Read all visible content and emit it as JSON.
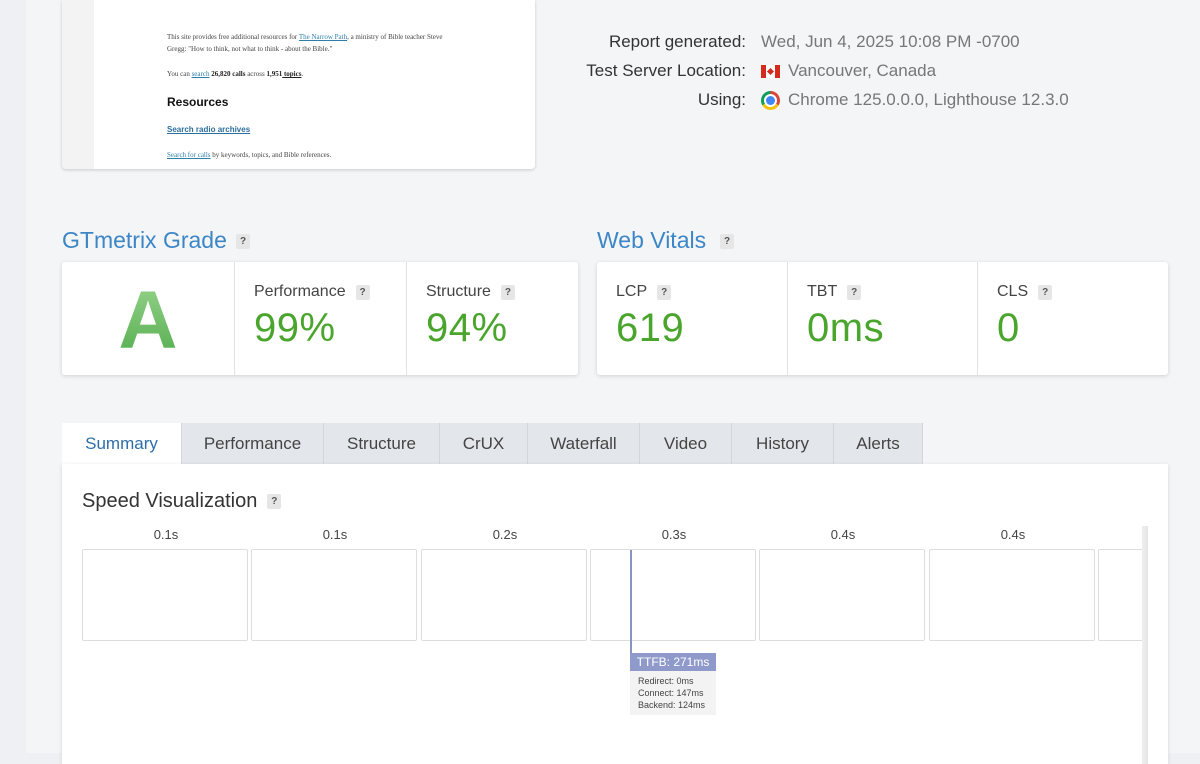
{
  "thumbnail": {
    "line1_pre": "This site provides free additional resources for ",
    "line1_link": "The Narrow Path",
    "line1_post": ", a ministry of Bible teacher Steve",
    "line2": "Gregg: \"How to think, not what to think - about the Bible.\"",
    "line3_pre": "You can ",
    "line3_link": "search",
    "line3_count": " 26,820 calls",
    "line3_mid": " across ",
    "line3_topics": "1,951",
    "line3_topics_link": " topics",
    "line3_end": ".",
    "heading": "Resources",
    "archive_link": "Search radio archives",
    "calls_link": "Search for calls",
    "calls_rest": " by keywords, topics, and Bible references."
  },
  "meta": {
    "report_label": "Report generated:",
    "report_value": "Wed, Jun 4, 2025 10:08 PM -0700",
    "location_label": "Test Server Location:",
    "location_value": "Vancouver, Canada",
    "using_label": "Using:",
    "using_value": "Chrome 125.0.0.0, Lighthouse 12.3.0"
  },
  "grade": {
    "title": "GTmetrix Grade",
    "letter": "A",
    "performance_label": "Performance",
    "performance_value": "99%",
    "structure_label": "Structure",
    "structure_value": "94%"
  },
  "vitals": {
    "title": "Web Vitals",
    "lcp_label": "LCP",
    "lcp_value": "619",
    "tbt_label": "TBT",
    "tbt_value": "0ms",
    "cls_label": "CLS",
    "cls_value": "0"
  },
  "help_mark": "?",
  "tabs": [
    "Summary",
    "Performance",
    "Structure",
    "CrUX",
    "Waterfall",
    "Video",
    "History",
    "Alerts"
  ],
  "active_tab": "Summary",
  "speed": {
    "title": "Speed Visualization",
    "frame_times": [
      "0.1s",
      "0.1s",
      "0.2s",
      "0.3s",
      "0.4s",
      "0.4s"
    ],
    "ttfb_label": "TTFB: 271ms",
    "redirect": "Redirect: 0ms",
    "connect": "Connect: 147ms",
    "backend": "Backend: 124ms"
  },
  "colors": {
    "accent_blue": "#3d86c6",
    "score_green": "#4aa52d",
    "ttfb_marker": "#8f9acb"
  }
}
